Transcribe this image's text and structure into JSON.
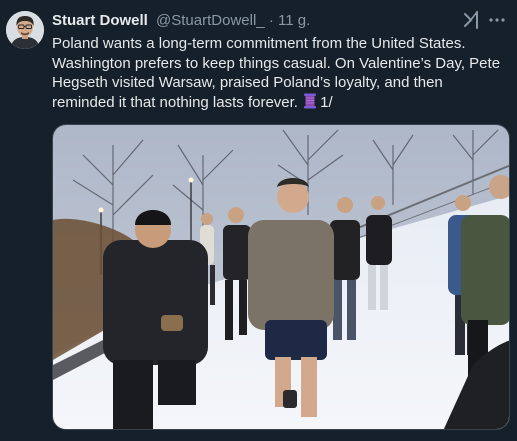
{
  "tweet": {
    "author_name": "Stuart Dowell",
    "author_handle": "@StuartDowell_",
    "separator": "·",
    "timestamp": "11 g.",
    "text_main": "Poland wants a long-term commitment from the United States. Washington prefers to keep things casual. On Valentine’s Day, Pete Hegseth visited Warsaw, praised Poland’s loyalty, and then reminded it that nothing lasts forever.",
    "thread_emoji": "thread-spool-icon",
    "text_suffix": "1/"
  },
  "colors": {
    "background": "#15202b",
    "text_primary": "#e7e9ea",
    "text_secondary": "#8b98a5",
    "border": "#38444d"
  },
  "icons": {
    "grok": "grok-icon",
    "more": "more-options-icon"
  }
}
